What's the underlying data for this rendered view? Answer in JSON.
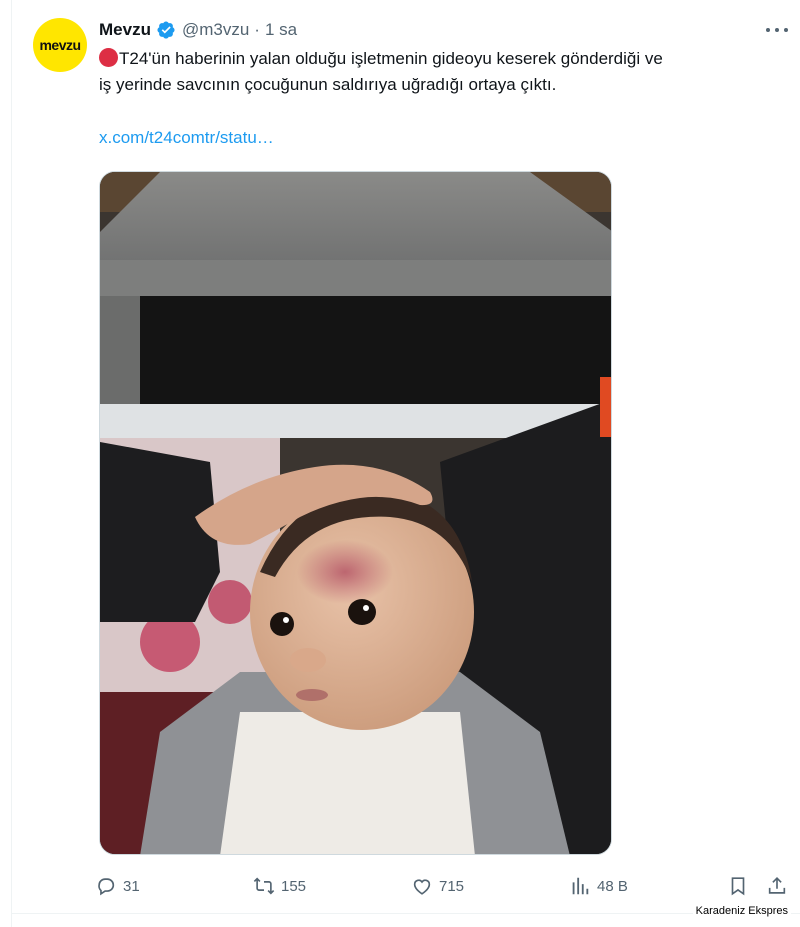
{
  "author": {
    "display_name": "Mevzu",
    "handle": "@m3vzu",
    "separator": "·",
    "time": "1 sa",
    "avatar_text": "mevzu",
    "avatar_color": "#ffe600",
    "verified_color": "#1d9bf0"
  },
  "tweet": {
    "line1": "T24'ün haberinin yalan olduğu işletmenin gideoyu keserek gönderdiği ve",
    "line2": "iş yerinde savcının çocuğunun saldırıya uğradığı ortaya çıktı.",
    "link": "x.com/t24comtr/statu…",
    "link_color": "#1d9bf0",
    "status_emoji": "red-circle-icon"
  },
  "actions": {
    "replies": "31",
    "reposts": "155",
    "likes": "715",
    "views": "48 B"
  },
  "watermark": "Karadeniz Ekspres",
  "icons": [
    "verified-badge-icon",
    "more-icon",
    "reply-icon",
    "repost-icon",
    "like-icon",
    "views-icon",
    "bookmark-icon",
    "share-icon"
  ]
}
